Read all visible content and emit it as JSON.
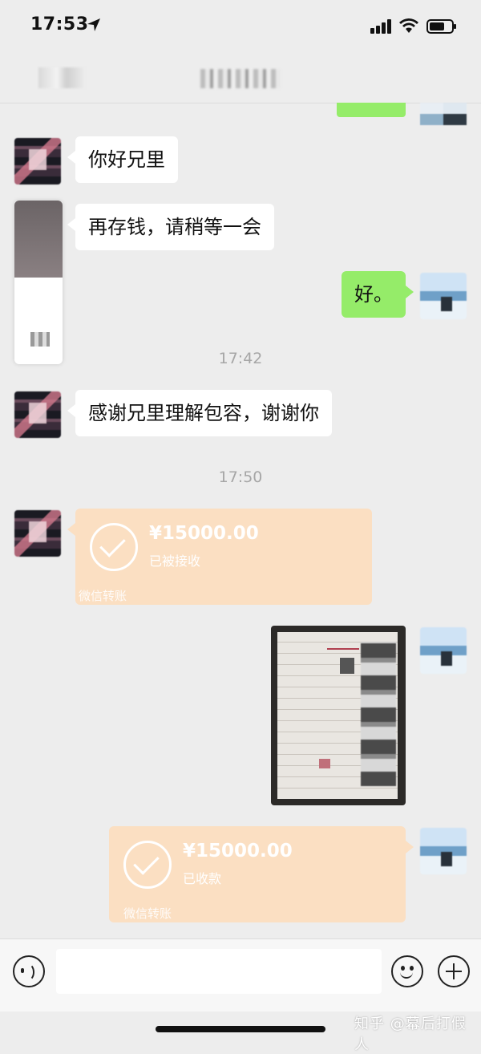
{
  "status_bar": {
    "time": "17:53",
    "icons": [
      "location-arrow-icon",
      "cellular-signal-icon",
      "wifi-icon",
      "battery-icon"
    ]
  },
  "messages": [
    {
      "side": "left",
      "type": "text",
      "text": "你好兄里"
    },
    {
      "side": "left",
      "type": "text",
      "text": "再存钱，请稍等一会"
    },
    {
      "side": "right",
      "type": "text",
      "text": "好。"
    },
    {
      "type": "timestamp",
      "text": "17:42"
    },
    {
      "side": "left",
      "type": "text",
      "text": "感谢兄里理解包容，谢谢你"
    },
    {
      "type": "timestamp",
      "text": "17:50"
    }
  ],
  "transfers": [
    {
      "side": "left",
      "amount": "¥15000.00",
      "status": "已被接收",
      "brand": "微信转账"
    },
    {
      "side": "right",
      "amount": "¥15000.00",
      "status": "已收款",
      "brand": "微信转账"
    }
  ],
  "watermark": "知乎 @幕后打假人",
  "colors": {
    "background": "#ededed",
    "outgoing_bubble": "#95ec69",
    "incoming_bubble": "#ffffff",
    "transfer_card": "#fbdfc2"
  }
}
